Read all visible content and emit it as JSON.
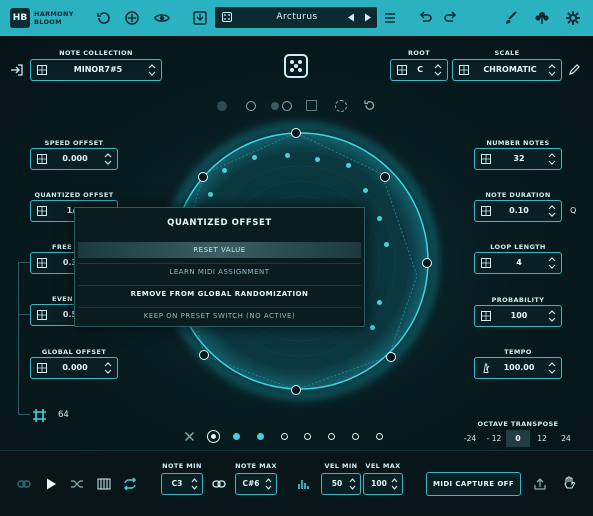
{
  "header": {
    "logo_mark": "HB",
    "logo_line1": "HARMONY",
    "logo_line2": "BLOOM",
    "preset_name": "Arcturus",
    "icons": [
      "undo-history-icon",
      "randomize-icon",
      "eye-icon",
      "save-icon",
      "prev-preset-icon",
      "next-preset-icon",
      "menu-icon",
      "undo-icon",
      "redo-icon",
      "brush-icon",
      "flower-icon",
      "gear-icon"
    ]
  },
  "note_collection": {
    "label": "NOTE COLLECTION",
    "value": "MINOR7#5"
  },
  "root": {
    "label": "ROOT",
    "value": "C"
  },
  "scale": {
    "label": "SCALE",
    "value": "CHROMATIC"
  },
  "left_params": [
    {
      "label": "SPEED OFFSET",
      "value": "0.000"
    },
    {
      "label": "QUANTIZED OFFSET",
      "value": "1/"
    },
    {
      "label": "FREE O",
      "value": "0.3"
    },
    {
      "label": "EVEN O",
      "value": "0.5"
    },
    {
      "label": "GLOBAL OFFSET",
      "value": "0.000"
    }
  ],
  "right_params": [
    {
      "label": "NUMBER NOTES",
      "value": "32"
    },
    {
      "label": "NOTE DURATION",
      "value": "0.10"
    },
    {
      "label": "LOOP LENGTH",
      "value": "4"
    },
    {
      "label": "PROBABILITY",
      "value": "100"
    },
    {
      "label": "TEMPO",
      "value": "100.00"
    }
  ],
  "note_duration_suffix": "Q",
  "grid_count": "64",
  "context_menu": {
    "title": "QUANTIZED OFFSET",
    "items": [
      "RESET VALUE",
      "LEARN MIDI ASSIGNMENT",
      "REMOVE FROM GLOBAL RANDOMIZATION",
      "KEEP ON PRESET SWITCH (NO ACTIVE)"
    ]
  },
  "octave_transpose": {
    "label": "OCTAVE TRANSPOSE",
    "options": [
      "-24",
      "- 12",
      "0",
      "12",
      "24"
    ],
    "selected": "0"
  },
  "bottom": {
    "note_min": {
      "label": "NOTE MIN",
      "value": "C3"
    },
    "note_max": {
      "label": "NOTE MAX",
      "value": "C#6"
    },
    "vel_min": {
      "label": "VEL MIN",
      "value": "50"
    },
    "vel_max": {
      "label": "VEL MAX",
      "value": "100"
    },
    "midi_capture": "MIDI CAPTURE OFF"
  },
  "colors": {
    "accent": "#2ab2c0",
    "ring": "#1fb3c4",
    "bg": "#07161a"
  }
}
